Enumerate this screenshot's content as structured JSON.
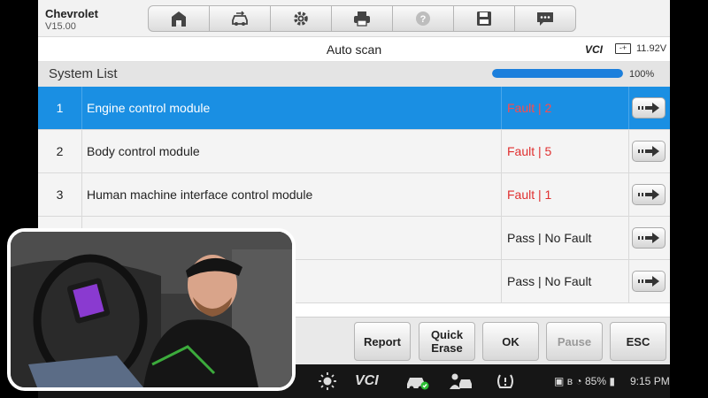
{
  "header": {
    "make": "Chevrolet",
    "version": "V15.00"
  },
  "toolbar": {
    "icons": [
      "home-icon",
      "vehicle-swap-icon",
      "settings-icon",
      "print-icon",
      "help-icon",
      "save-icon",
      "message-icon"
    ]
  },
  "titlebar": {
    "title": "Auto scan",
    "vci_label": "VCI",
    "battery_glyph": "-+",
    "voltage": "11.92V"
  },
  "system_list": {
    "label": "System List",
    "progress_percent": 100,
    "progress_text": "100%",
    "rows": [
      {
        "num": "1",
        "name": "Engine control module",
        "status": "Fault | 2",
        "fault": true,
        "selected": true
      },
      {
        "num": "2",
        "name": "Body control module",
        "status": "Fault | 5",
        "fault": true,
        "selected": false
      },
      {
        "num": "3",
        "name": "Human machine interface control module",
        "status": "Fault | 1",
        "fault": true,
        "selected": false
      },
      {
        "num": "",
        "name": "",
        "status": "Pass | No Fault",
        "fault": false,
        "selected": false
      },
      {
        "num": "",
        "name": "",
        "status": "Pass | No Fault",
        "fault": false,
        "selected": false
      }
    ]
  },
  "actions": {
    "report": "Report",
    "quick_erase_1": "Quick",
    "quick_erase_2": "Erase",
    "ok": "OK",
    "pause": "Pause",
    "esc": "ESC"
  },
  "navbar": {
    "vci": "VCI",
    "battery_percent": "85%",
    "time": "9:15 PM"
  },
  "colors": {
    "selected_row": "#1a8fe3",
    "fault_text": "#e03030",
    "progress_fill": "#1b7fdc",
    "vci_accent": "#2bbf34"
  }
}
